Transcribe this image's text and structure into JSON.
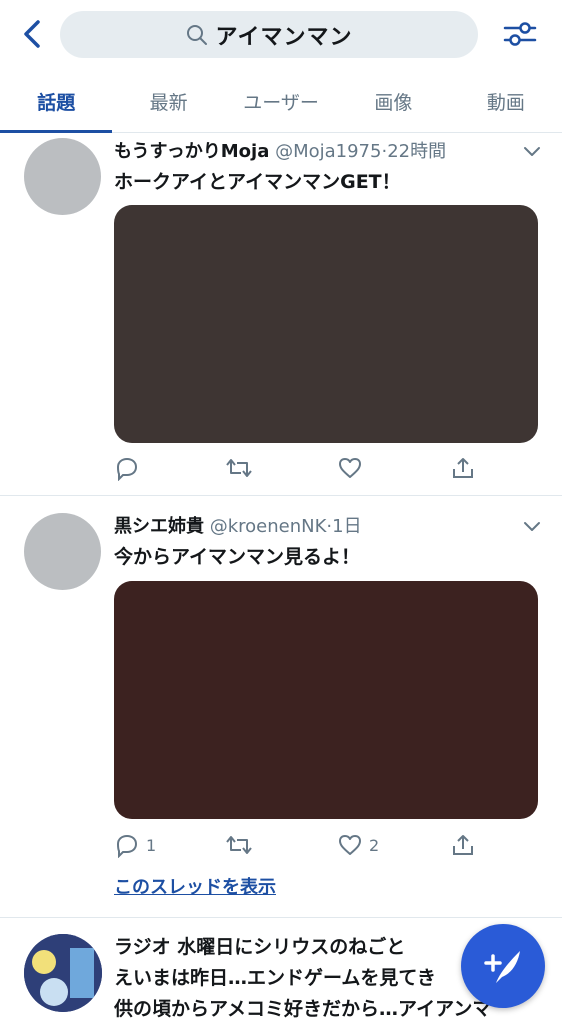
{
  "search": {
    "query": "アイマンマン"
  },
  "tabs": [
    {
      "label": "話題",
      "active": true
    },
    {
      "label": "最新",
      "active": false
    },
    {
      "label": "ユーザー",
      "active": false
    },
    {
      "label": "画像",
      "active": false
    },
    {
      "label": "動画",
      "active": false
    }
  ],
  "tweets": [
    {
      "name": "もうすっかりMoja",
      "handle": "@Moja1975",
      "time": "22時間",
      "text": "ホークアイとアイマンマンGET！",
      "media_color": "#3e3533",
      "reply_count": "",
      "like_count": ""
    },
    {
      "name": "黒シエ姉貴",
      "handle": "@kroenenNK",
      "time": "1日",
      "text": "今からアイマンマン見るよ！",
      "media_color": "#3c2220",
      "reply_count": "1",
      "like_count": "2",
      "thread_link": "このスレッドを表示"
    },
    {
      "lines": [
        "ラジオ 水曜日にシリウスのねごと",
        "えいまは昨日…エンドゲームを見てき",
        "供の頃からアメコミ好きだから…アイアンマ"
      ]
    }
  ],
  "colors": {
    "accent": "#1d4fa3",
    "fab": "#2a5bd7",
    "muted": "#657786"
  }
}
